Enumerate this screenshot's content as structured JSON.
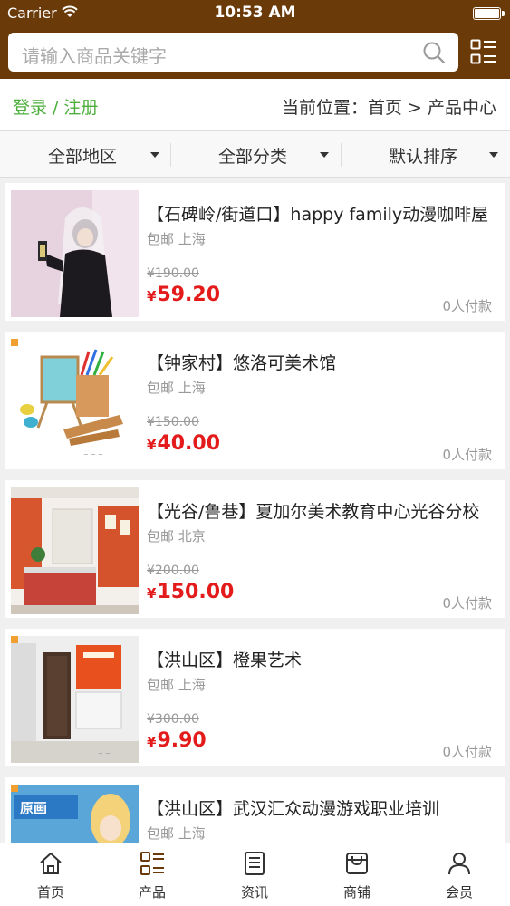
{
  "status_bar": {
    "carrier": "Carrier",
    "time": "10:53 AM"
  },
  "search": {
    "placeholder": "请输入商品关键字"
  },
  "crumb": {
    "login": "登录",
    "separator": "/",
    "register": "注册",
    "location_label": "当前位置：",
    "home": "首页",
    "arrow": ">",
    "current": "产品中心"
  },
  "filters": [
    {
      "label": "全部地区"
    },
    {
      "label": "全部分类"
    },
    {
      "label": "默认排序"
    }
  ],
  "products": [
    {
      "title": "【石碑岭/街道口】happy family动漫咖啡屋",
      "sub": "包邮 上海",
      "old_price": "¥190.00",
      "price": "59.20",
      "paid": "0人付款"
    },
    {
      "title": "【钟家村】悠洛可美术馆",
      "sub": "包邮 上海",
      "old_price": "¥150.00",
      "price": "40.00",
      "paid": "0人付款"
    },
    {
      "title": "【光谷/鲁巷】夏加尔美术教育中心光谷分校",
      "sub": "包邮 北京",
      "old_price": "¥200.00",
      "price": "150.00",
      "paid": "0人付款"
    },
    {
      "title": "【洪山区】橙果艺术",
      "sub": "包邮 上海",
      "old_price": "¥300.00",
      "price": "9.90",
      "paid": "0人付款"
    },
    {
      "title": "【洪山区】武汉汇众动漫游戏职业培训",
      "sub": "包邮 上海",
      "old_price": "",
      "price": "",
      "paid": ""
    }
  ],
  "price_symbol": "¥",
  "tabs": [
    {
      "label": "首页",
      "icon": "home-icon"
    },
    {
      "label": "产品",
      "icon": "grid-list-icon",
      "active": true
    },
    {
      "label": "资讯",
      "icon": "document-icon"
    },
    {
      "label": "商铺",
      "icon": "store-icon"
    },
    {
      "label": "会员",
      "icon": "person-icon"
    }
  ],
  "colors": {
    "header_bg": "#6b3a09",
    "login_green": "#4caf3b",
    "price_red": "#e31b1b",
    "active_tab": "#6b3a09"
  }
}
